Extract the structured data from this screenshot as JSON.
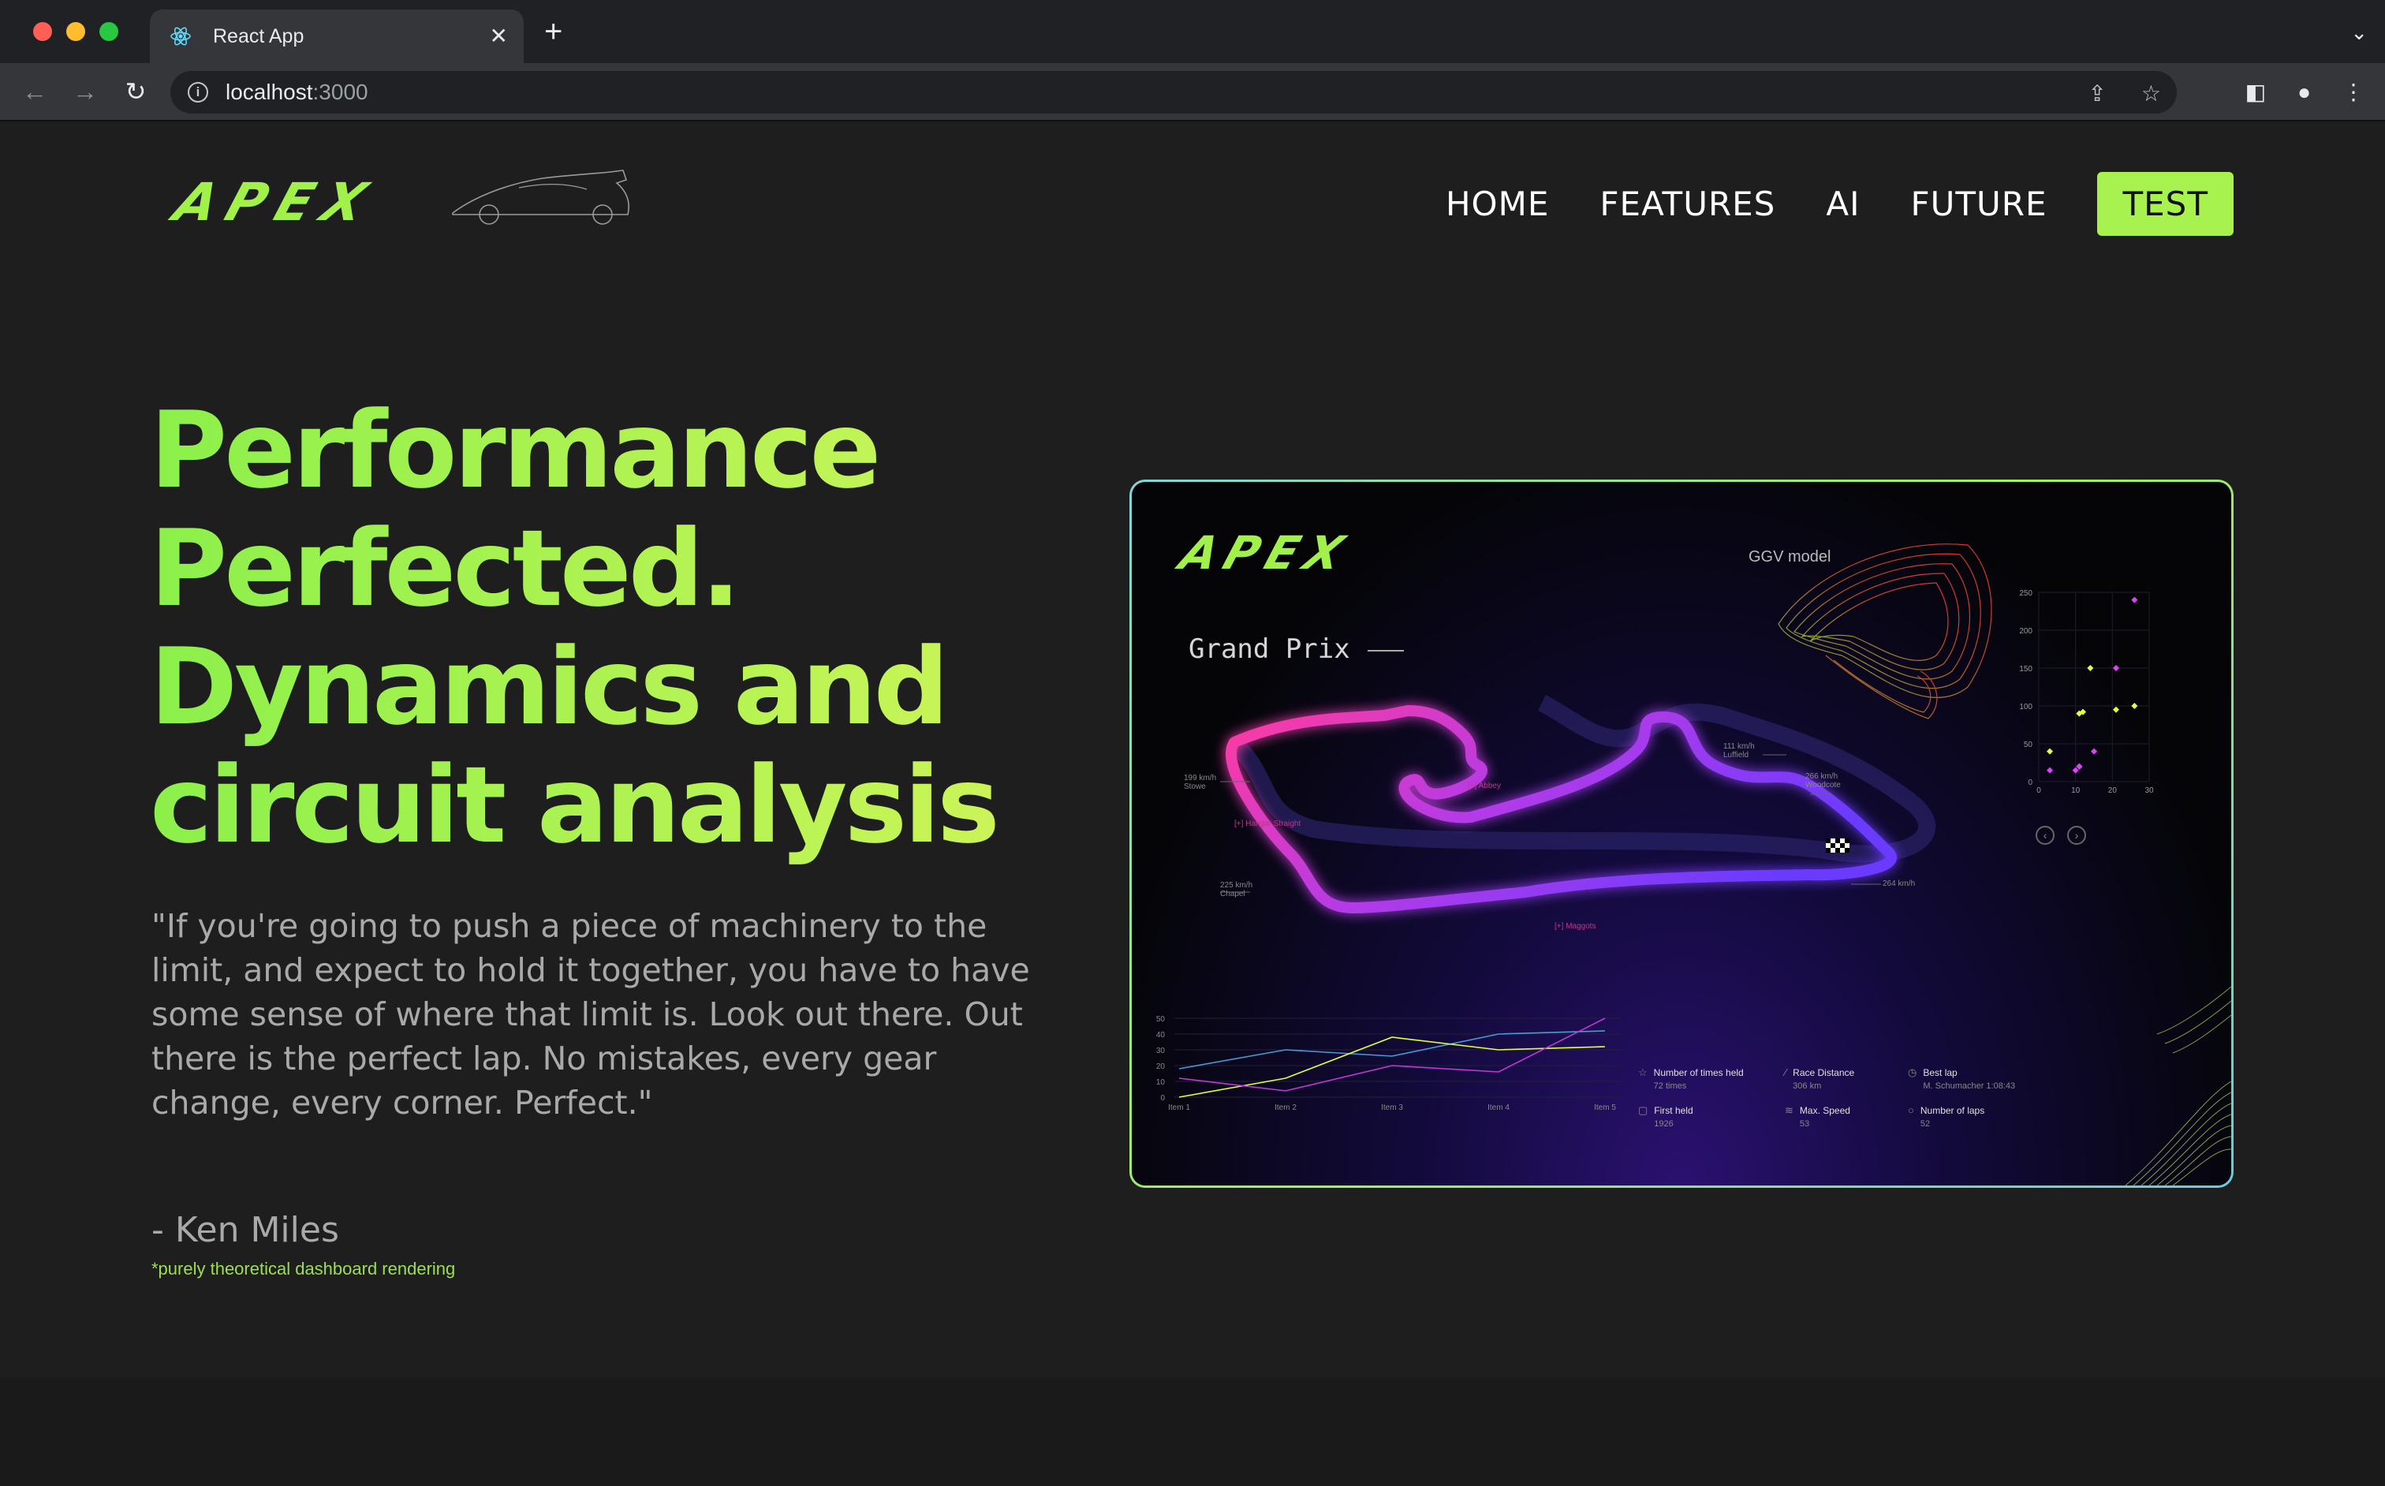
{
  "browser": {
    "tab_title": "React App",
    "url_host": "localhost",
    "url_port": ":3000"
  },
  "nav": {
    "logo_text": "APEX",
    "items": [
      "HOME",
      "FEATURES",
      "AI",
      "FUTURE"
    ],
    "cta": "TEST"
  },
  "hero": {
    "title_lines": [
      "Performance",
      "Perfected.",
      "Dynamics and",
      "circuit analysis"
    ],
    "quote": "\"If you're going to push a piece of machinery to the limit, and expect to hold it together, you have to have some sense of where that limit is. Look out there. Out there is the perfect lap. No mistakes, every gear change, every corner. Perfect.\"",
    "author": "- Ken Miles",
    "note": "*purely theoretical dashboard rendering"
  },
  "dashboard": {
    "logo_text": "APEX",
    "title": "Grand Prix",
    "ggv_label": "GGV model",
    "track_labels": [
      {
        "name": "Stowe",
        "speed": "199 km/h"
      },
      {
        "name": "Abbey",
        "speed": "[+]"
      },
      {
        "name": "Luffield",
        "speed": "111 km/h"
      },
      {
        "name": "Woodcote",
        "speed": "266 km/h"
      },
      {
        "name": "Hangar Straight",
        "speed": "[+]"
      },
      {
        "name": "Chapel",
        "speed": "225 km/h"
      },
      {
        "name": "Maggots",
        "speed": "[+]"
      },
      {
        "name": "",
        "speed": "264 km/h"
      }
    ],
    "stats": [
      {
        "icon": "☆",
        "label": "Number of times held",
        "value": "72 times"
      },
      {
        "icon": "⁄",
        "label": "Race Distance",
        "value": "306 km"
      },
      {
        "icon": "◷",
        "label": "Best lap",
        "value": "M. Schumacher 1:08:43"
      },
      {
        "icon": "▢",
        "label": "First held",
        "value": "1926"
      },
      {
        "icon": "≋",
        "label": "Max. Speed",
        "value": "53"
      },
      {
        "icon": "○",
        "label": "Number of laps",
        "value": "52"
      }
    ],
    "colors": {
      "accent": "#a7f24e",
      "magenta": "#e040fb",
      "yellow": "#e6ff3a",
      "blue": "#4a9ad9"
    }
  },
  "chart_data": [
    {
      "type": "line",
      "categories": [
        "Item 1",
        "Item 2",
        "Item 3",
        "Item 4",
        "Item 5"
      ],
      "ylim": [
        0,
        50
      ],
      "yticks": [
        0,
        10,
        20,
        30,
        40,
        50
      ],
      "series": [
        {
          "color": "#4a9ad9",
          "values": [
            18,
            30,
            26,
            40,
            42
          ]
        },
        {
          "color": "#e6ff3a",
          "values": [
            0,
            12,
            38,
            30,
            32
          ]
        },
        {
          "color": "#c03ad8",
          "values": [
            12,
            4,
            20,
            16,
            50
          ]
        }
      ]
    },
    {
      "type": "scatter",
      "xlim": [
        0,
        30
      ],
      "ylim": [
        0,
        250
      ],
      "xticks": [
        0,
        10,
        20,
        30
      ],
      "yticks": [
        0,
        50,
        100,
        150,
        200,
        250
      ],
      "series": [
        {
          "color": "#e6ff3a",
          "points": [
            [
              3,
              40
            ],
            [
              11,
              90
            ],
            [
              12,
              92
            ],
            [
              14,
              150
            ],
            [
              21,
              95
            ],
            [
              26,
              100
            ],
            [
              11,
              20
            ]
          ]
        },
        {
          "color": "#e040fb",
          "points": [
            [
              3,
              15
            ],
            [
              10,
              15
            ],
            [
              11,
              20
            ],
            [
              15,
              40
            ],
            [
              21,
              150
            ],
            [
              26,
              240
            ]
          ]
        }
      ]
    }
  ]
}
